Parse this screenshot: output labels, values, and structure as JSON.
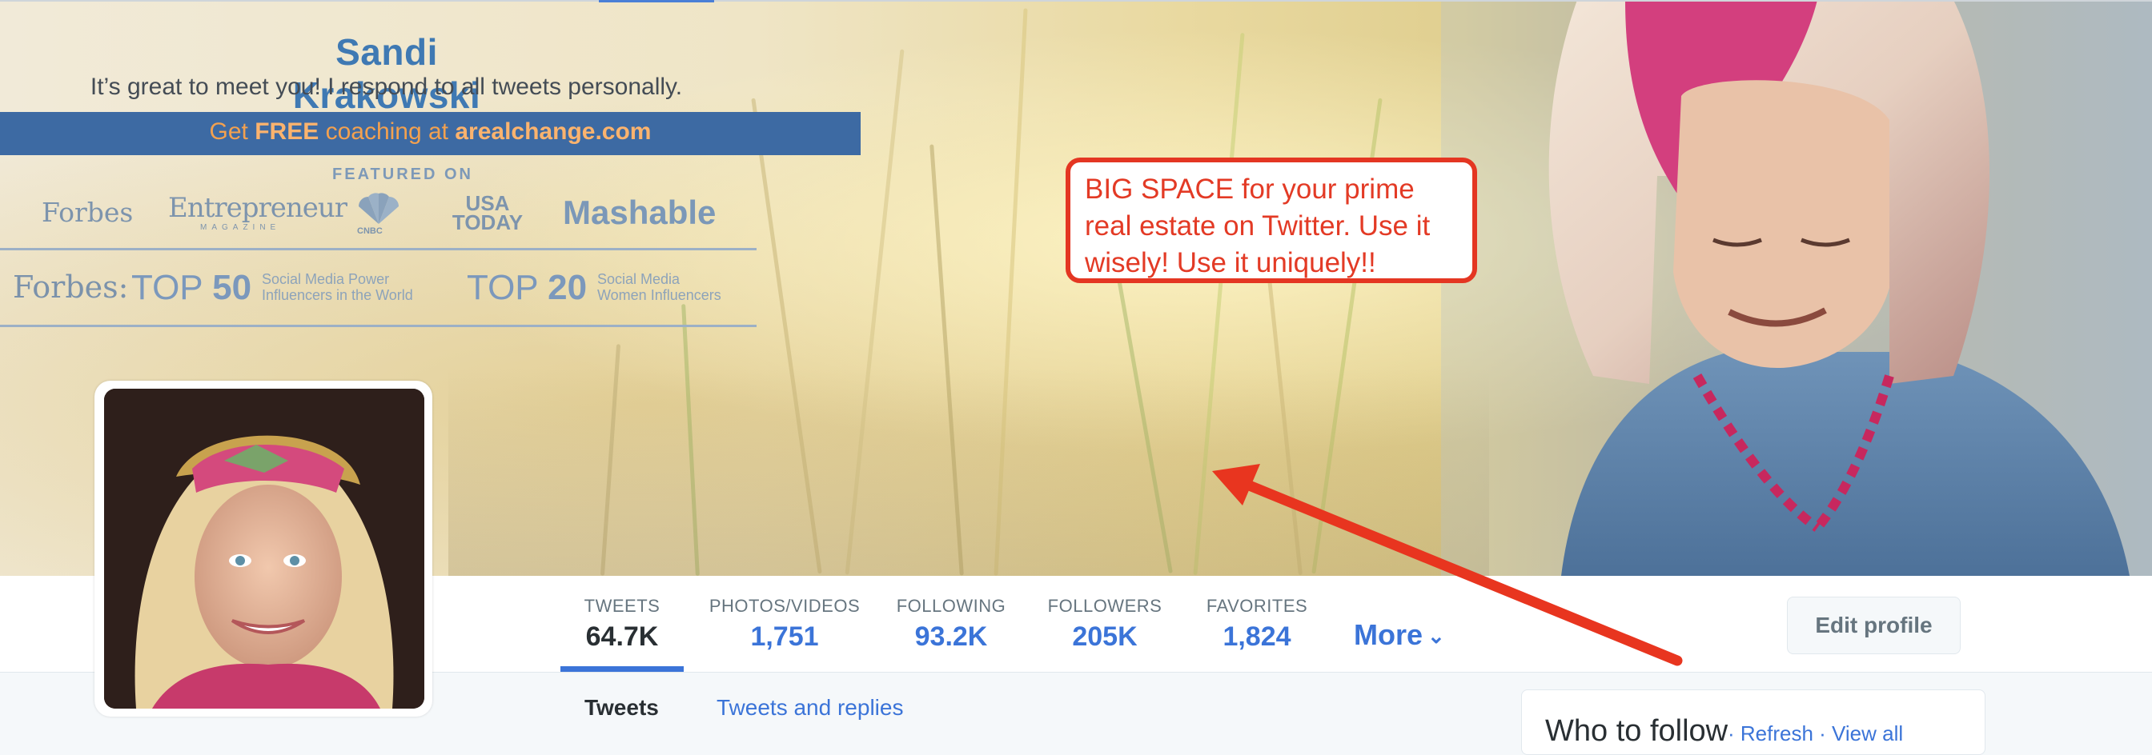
{
  "banner": {
    "name": "Sandi Krakowski",
    "tagline": "It’s great to meet you! I respond to all tweets personally.",
    "coaching_prefix": "Get ",
    "coaching_free": "FREE",
    "coaching_mid": " coaching at ",
    "coaching_site": "arealchange.com",
    "featured_on": "FEATURED ON",
    "logos": {
      "forbes": "Forbes",
      "entrepreneur": "Entrepreneur",
      "entrepreneur_sub": "MAGAZINE",
      "cnbc": "CNBC",
      "usa_today_1": "USA",
      "usa_today_2": "TODAY",
      "mashable": "Mashable"
    },
    "forbes_award": "Forbes:",
    "top50_prefix": "TOP ",
    "top50_number": "50",
    "top50_line1": "Social Media Power",
    "top50_line2": "Influencers in the World",
    "top20_prefix": "TOP ",
    "top20_number": "20",
    "top20_line1": "Social Media",
    "top20_line2": "Women Influencers"
  },
  "callout": {
    "line1": "BIG SPACE for your prime",
    "line2": "real estate on Twitter. Use it",
    "line3": "wisely! Use it uniquely!!"
  },
  "stats": [
    {
      "label": "TWEETS",
      "value": "64.7K"
    },
    {
      "label": "PHOTOS/VIDEOS",
      "value": "1,751"
    },
    {
      "label": "FOLLOWING",
      "value": "93.2K"
    },
    {
      "label": "FOLLOWERS",
      "value": "205K"
    },
    {
      "label": "FAVORITES",
      "value": "1,824"
    }
  ],
  "more_label": "More",
  "edit_profile_label": "Edit profile",
  "tabs": {
    "tweets": "Tweets",
    "replies": "Tweets and replies"
  },
  "who_to_follow": {
    "title": "Who to follow",
    "links": "· Refresh · View all"
  },
  "colors": {
    "accent": "#3b74d8",
    "callout_red": "#e43622",
    "banner_strip": "#3d6aa3"
  },
  "icons": {
    "more": "chevron-down-icon",
    "arrow": "red-arrow-annotation"
  }
}
